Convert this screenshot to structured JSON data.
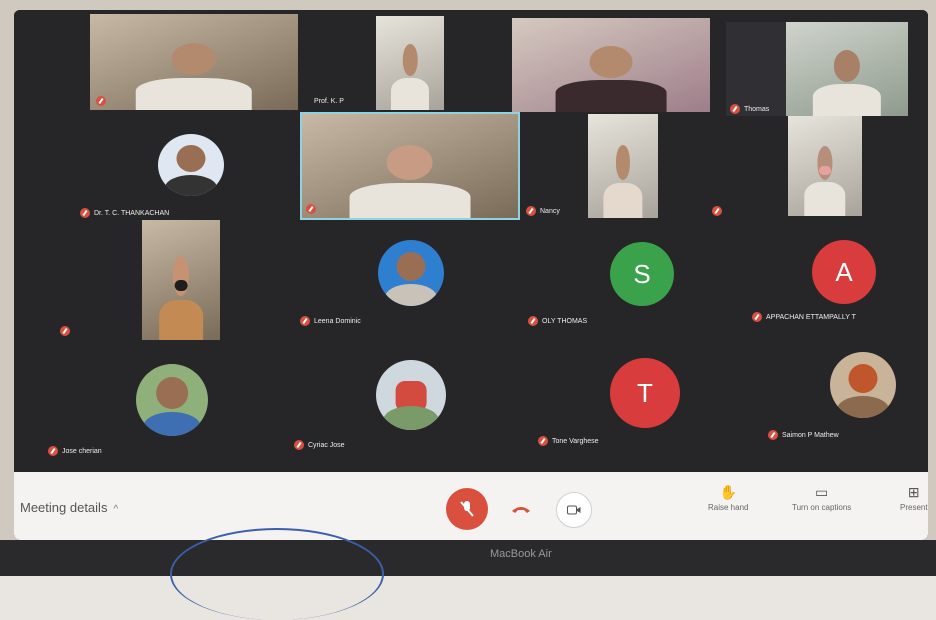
{
  "participants": [
    {
      "name": "",
      "type": "video"
    },
    {
      "name": "Prof. K. P",
      "type": "video"
    },
    {
      "name": "",
      "type": "video"
    },
    {
      "name": "Thomas",
      "type": "video"
    },
    {
      "name": "Dr. T. C. THANKACHAN",
      "type": "photo"
    },
    {
      "name": "",
      "type": "video"
    },
    {
      "name": "Nancy",
      "type": "video"
    },
    {
      "name": "",
      "type": "video"
    },
    {
      "name": "",
      "type": "video"
    },
    {
      "name": "Leena Dominic",
      "type": "photo"
    },
    {
      "name": "OLY THOMAS",
      "type": "letter",
      "letter": "S",
      "color": "#3aa24a"
    },
    {
      "name": "APPACHAN ETTAMPALLY T",
      "type": "letter",
      "letter": "A",
      "color": "#d93c3c"
    },
    {
      "name": "Jose cherian",
      "type": "photo"
    },
    {
      "name": "Cyriac Jose",
      "type": "photo"
    },
    {
      "name": "Tone Varghese",
      "type": "letter",
      "letter": "T",
      "color": "#d93c3c"
    },
    {
      "name": "Saimon P Mathew",
      "type": "photo"
    }
  ],
  "toolbar": {
    "meeting_details": "Meeting details",
    "caret": "^",
    "raise_hand": "Raise hand",
    "turn_on_captions": "Turn on captions",
    "present": "Present"
  },
  "laptop": {
    "brand": "MacBook Air"
  },
  "colors": {
    "accent_red": "#d9503e",
    "green": "#3aa24a"
  }
}
